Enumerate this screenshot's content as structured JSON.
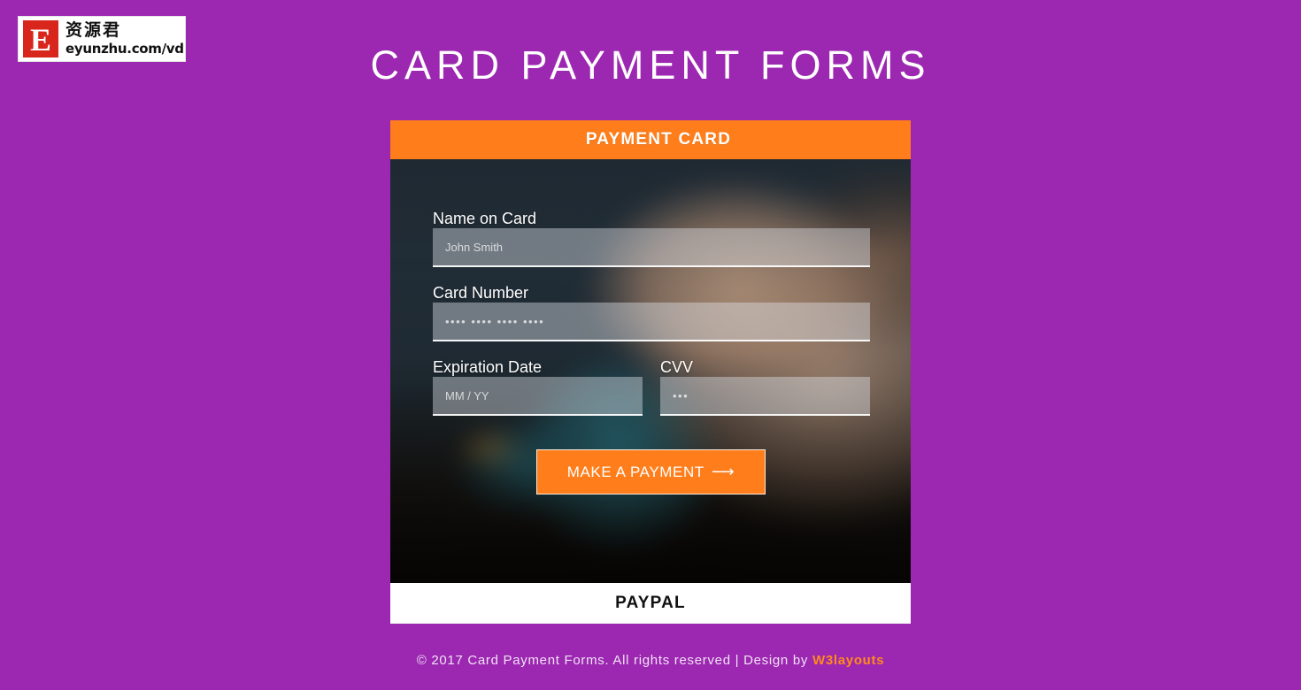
{
  "watermark": {
    "mark_letter": "E",
    "cn_text": "资源君",
    "url_text": "eyunzhu.com/vdisk"
  },
  "page": {
    "title": "CARD PAYMENT FORMS",
    "background_color": "#9C27B0",
    "accent_color": "#FF7E1B"
  },
  "widget": {
    "tab_active_label": "PAYMENT CARD",
    "tab_secondary_label": "PAYPAL",
    "fields": [
      {
        "label": "Name on Card",
        "placeholder": "John Smith",
        "value": ""
      },
      {
        "label": "Card Number",
        "placeholder": "•••• •••• •••• ••••",
        "value": ""
      },
      {
        "label": "Expiration Date",
        "placeholder": "MM / YY",
        "value": ""
      },
      {
        "label": "CVV",
        "placeholder": "•••",
        "value": ""
      }
    ],
    "submit_label": "MAKE A PAYMENT",
    "submit_arrow": "⟶"
  },
  "footer": {
    "copyright_text": "© 2017 Card Payment Forms. All rights reserved | Design by",
    "brand_label": "W3layouts"
  }
}
